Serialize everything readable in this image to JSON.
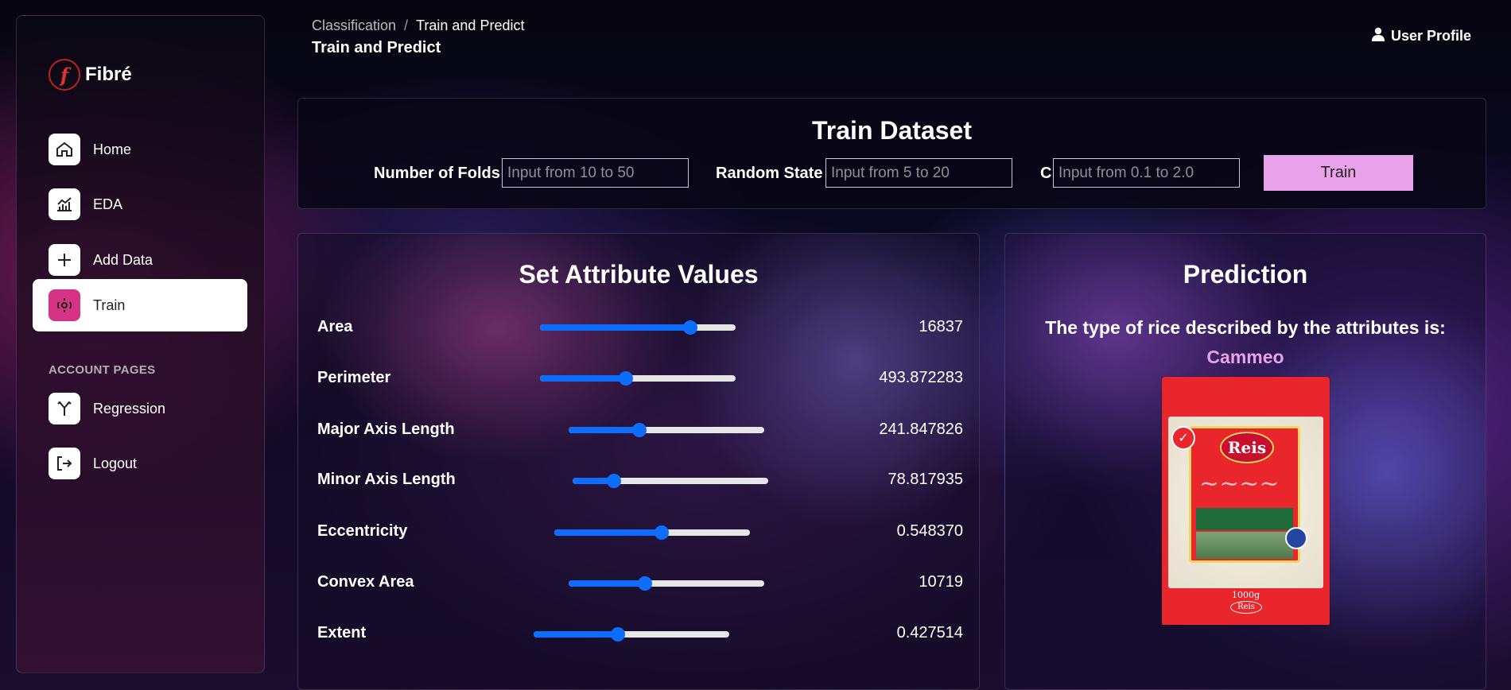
{
  "brand": {
    "name": "Fibré",
    "logo_letter": "f"
  },
  "sidebar": {
    "items": [
      {
        "label": "Home",
        "icon": "home-icon"
      },
      {
        "label": "EDA",
        "icon": "chart-icon"
      },
      {
        "label": "Add Data",
        "icon": "plus-icon"
      },
      {
        "label": "Train",
        "icon": "train-icon",
        "active": true
      }
    ],
    "section_label": "ACCOUNT PAGES",
    "account_items": [
      {
        "label": "Regression",
        "icon": "regression-icon"
      },
      {
        "label": "Logout",
        "icon": "logout-icon"
      }
    ]
  },
  "header": {
    "breadcrumb_parent": "Classification",
    "breadcrumb_separator": "/",
    "breadcrumb_current": "Train and Predict",
    "page_title": "Train and Predict",
    "user_profile": "User Profile"
  },
  "train": {
    "title": "Train Dataset",
    "folds_label": "Number of Folds",
    "folds_placeholder": "Input from 10 to 50",
    "random_state_label": "Random State",
    "random_state_placeholder": "Input from 5 to 20",
    "c_label": "C",
    "c_placeholder": "Input from 0.1 to 2.0",
    "button_label": "Train"
  },
  "attributes": {
    "title": "Set Attribute Values",
    "items": [
      {
        "name": "Area",
        "value": "16837",
        "level": 0.77
      },
      {
        "name": "Perimeter",
        "value": "493.872283",
        "level": 0.44
      },
      {
        "name": "Major Axis Length",
        "value": "241.847826",
        "level": 0.36
      },
      {
        "name": "Minor Axis Length",
        "value": "78.817935",
        "level": 0.21
      },
      {
        "name": "Eccentricity",
        "value": "0.548370",
        "level": 0.55
      },
      {
        "name": "Convex Area",
        "value": "10719",
        "level": 0.39
      },
      {
        "name": "Extent",
        "value": "0.427514",
        "level": 0.43
      }
    ]
  },
  "prediction": {
    "title": "Prediction",
    "text": "The type of rice described by the attributes is:",
    "class": "Cammeo",
    "image_brand": "Reis",
    "image_weight": "1000g"
  },
  "colors": {
    "accent_pink": "#e9a2ea",
    "slider_blue": "#0d6efd",
    "active_icon": "#d63384"
  }
}
